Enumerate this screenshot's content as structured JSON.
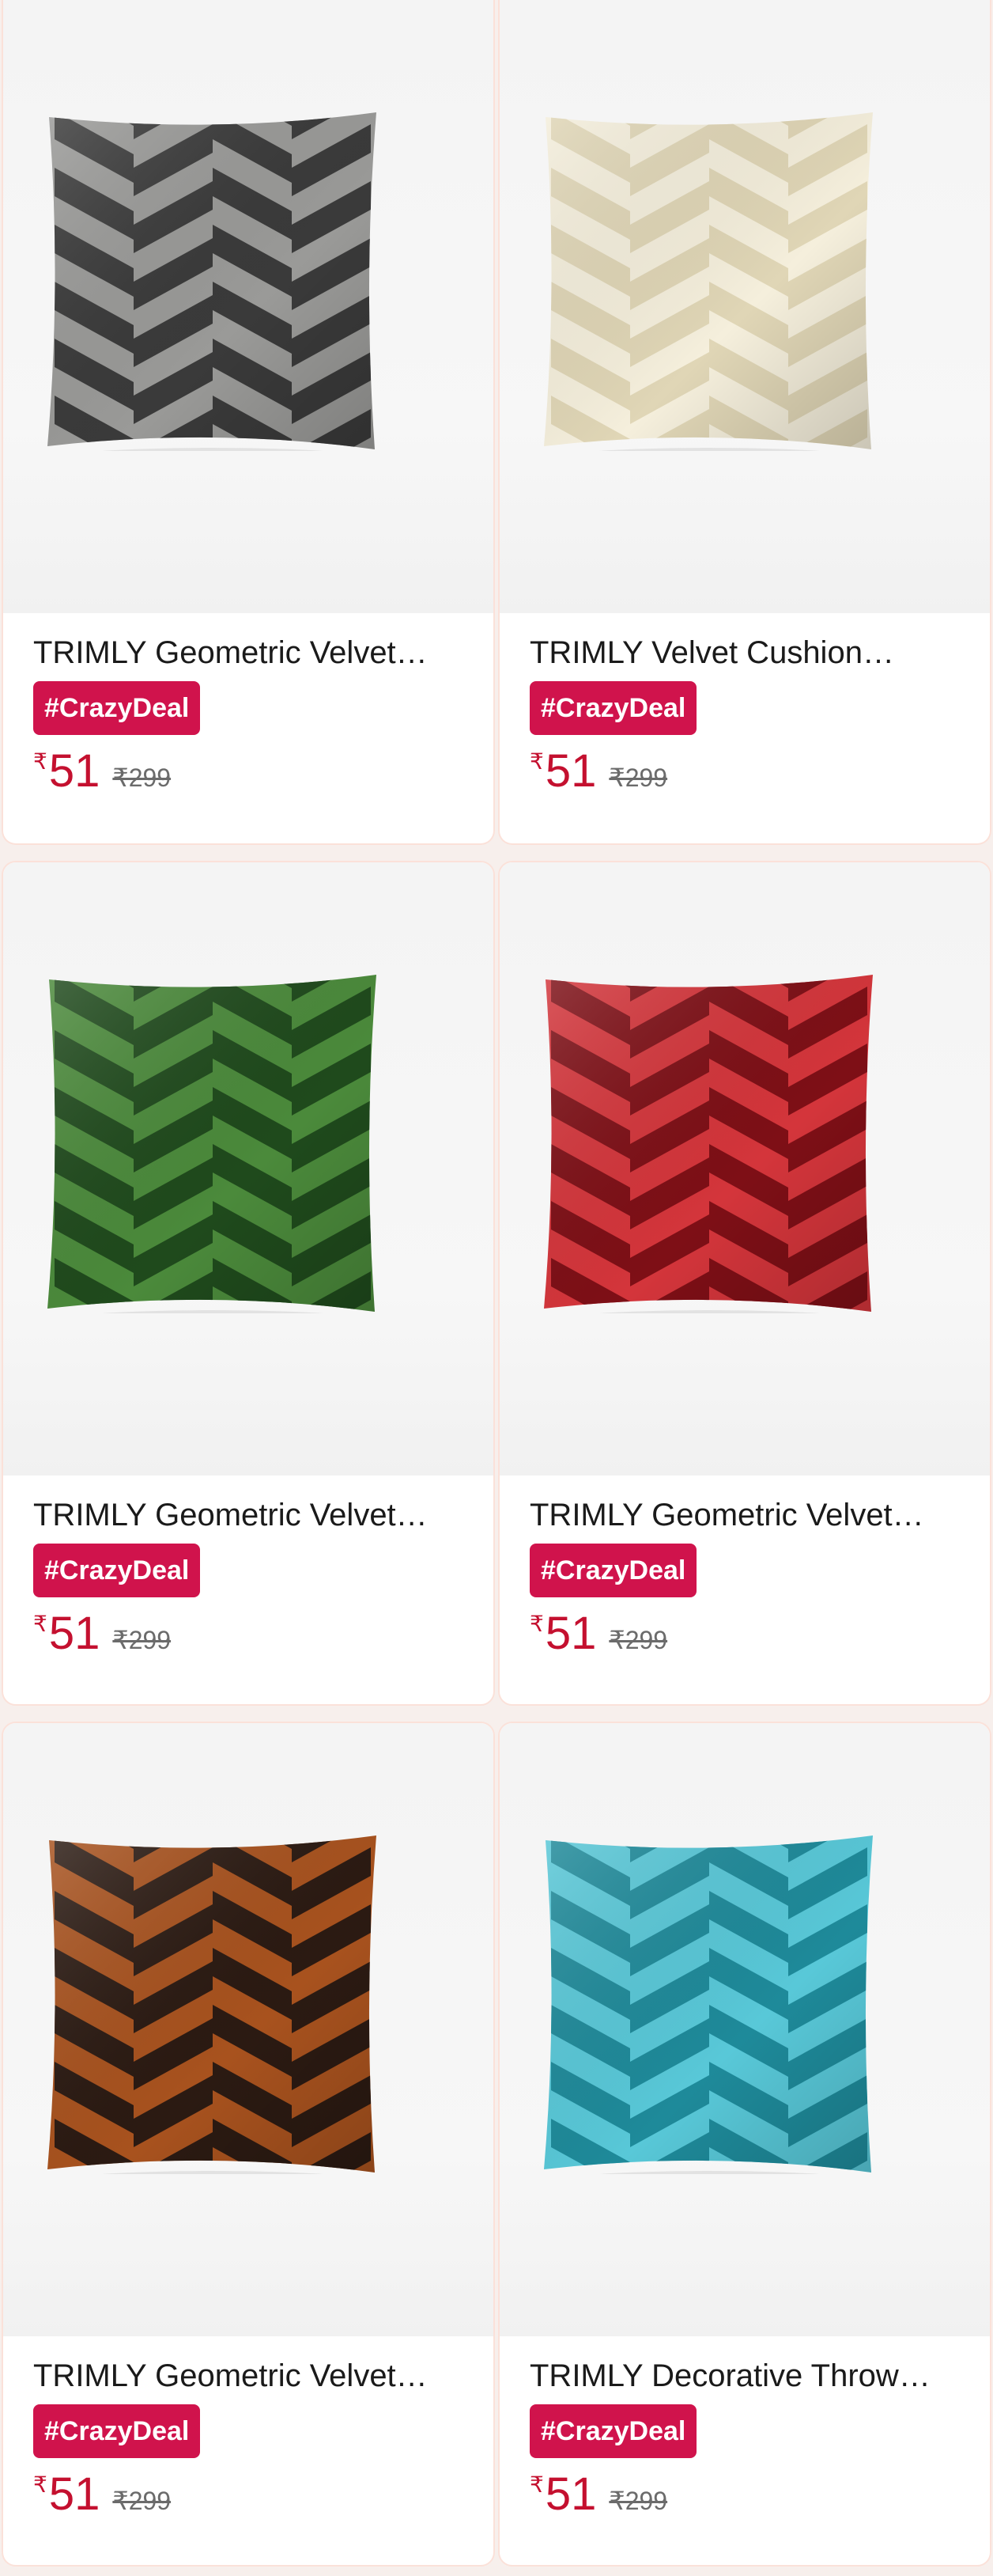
{
  "products": [
    {
      "title": "TRIMLY Geometric Velvet…",
      "badge": "#CrazyDeal",
      "currency": "₹",
      "price": "51",
      "mrp": "₹299",
      "color_dark": "#3a3a3a",
      "color_light": "#9a9a98",
      "image": "grey-chevron-pillow-icon"
    },
    {
      "title": "TRIMLY Velvet Cushion…",
      "badge": "#CrazyDeal",
      "currency": "₹",
      "price": "51",
      "mrp": "₹299",
      "color_dark": "#e0d6b6",
      "color_light": "#f5efdc",
      "image": "cream-chevron-pillow-icon"
    },
    {
      "title": "TRIMLY Geometric Velvet…",
      "badge": "#CrazyDeal",
      "currency": "₹",
      "price": "51",
      "mrp": "₹299",
      "color_dark": "#1f4a1c",
      "color_light": "#4b8a3b",
      "image": "green-chevron-pillow-icon"
    },
    {
      "title": "TRIMLY Geometric Velvet…",
      "badge": "#CrazyDeal",
      "currency": "₹",
      "price": "51",
      "mrp": "₹299",
      "color_dark": "#7e0f16",
      "color_light": "#d4353b",
      "image": "red-chevron-pillow-icon"
    },
    {
      "title": "TRIMLY Geometric Velvet…",
      "badge": "#CrazyDeal",
      "currency": "₹",
      "price": "51",
      "mrp": "₹299",
      "color_dark": "#2b1a12",
      "color_light": "#a8521e",
      "image": "brown-chevron-pillow-icon"
    },
    {
      "title": "TRIMLY Decorative Throw…",
      "badge": "#CrazyDeal",
      "currency": "₹",
      "price": "51",
      "mrp": "₹299",
      "color_dark": "#1e8a9a",
      "color_light": "#58c8d8",
      "image": "turquoise-chevron-pillow-icon"
    }
  ]
}
